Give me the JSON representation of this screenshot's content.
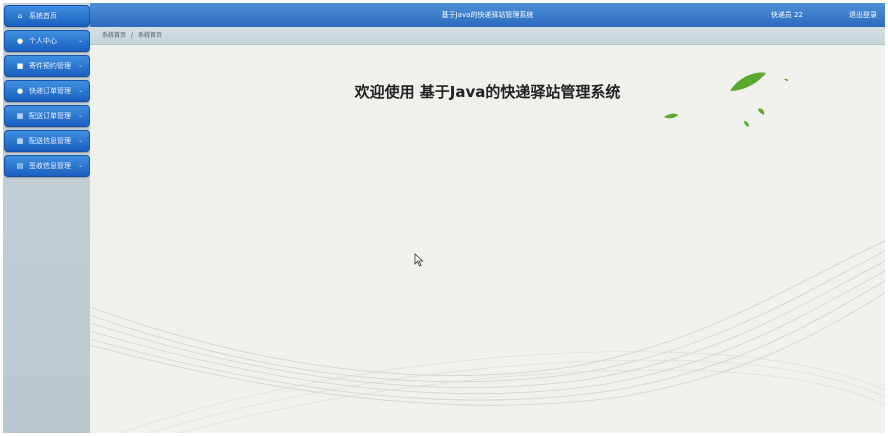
{
  "app": {
    "title": "基于Java的快递驿站管理系统",
    "user": "快递员 22",
    "logout": "退出登录"
  },
  "sidebar": {
    "items": [
      {
        "label": "系统首页",
        "icon": "home-icon",
        "glyph": "⌂",
        "active": true
      },
      {
        "label": "个人中心",
        "icon": "user-icon",
        "glyph": "●",
        "chevron": "⌄"
      },
      {
        "label": "寄件预约管理",
        "icon": "delivery-icon",
        "glyph": "■",
        "chevron": "⌄"
      },
      {
        "label": "快递订单管理",
        "icon": "location-pin-icon",
        "glyph": "●",
        "chevron": "⌄"
      },
      {
        "label": "配送订单管理",
        "icon": "grid-icon",
        "glyph": "▦",
        "chevron": "⌄"
      },
      {
        "label": "配送信息管理",
        "icon": "grid-icon",
        "glyph": "▦",
        "chevron": "⌄"
      },
      {
        "label": "签收信息管理",
        "icon": "list-icon",
        "glyph": "▤",
        "chevron": "⌄"
      }
    ]
  },
  "breadcrumb": {
    "home": "系统首页",
    "separator": "/",
    "current": "系统首页"
  },
  "main": {
    "welcome": "欢迎使用 基于Java的快递驿站管理系统"
  },
  "colors": {
    "accent": "#2c6bbd",
    "sidebar_button": "#1a5fc0",
    "leaf": "#5aa82d"
  }
}
